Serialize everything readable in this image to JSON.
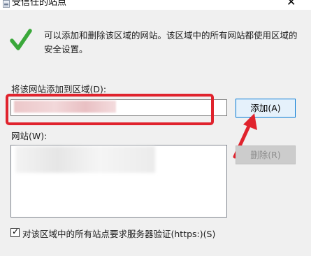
{
  "window": {
    "title": "受信任的站点",
    "close_glyph": "✕",
    "icon": "document-list-icon"
  },
  "info": {
    "icon": "green-check-icon",
    "text": "可以添加和删除该区域的网站。该区域中的所有网站都使用区域的安全设置。"
  },
  "add_site": {
    "label": "将该网站添加到区域(D):",
    "input_value": "",
    "button_label": "添加(A)"
  },
  "websites": {
    "label": "网站(W):",
    "items": [],
    "remove_button_label": "删除(R)"
  },
  "https_option": {
    "checked": true,
    "label": "对该区域中的所有站点要求服务器验证(https:)(S)"
  },
  "colors": {
    "highlight": "#e0232d",
    "arrow": "#e0232d",
    "check": "#3aa83a",
    "button_focus_border": "#0078d7"
  }
}
